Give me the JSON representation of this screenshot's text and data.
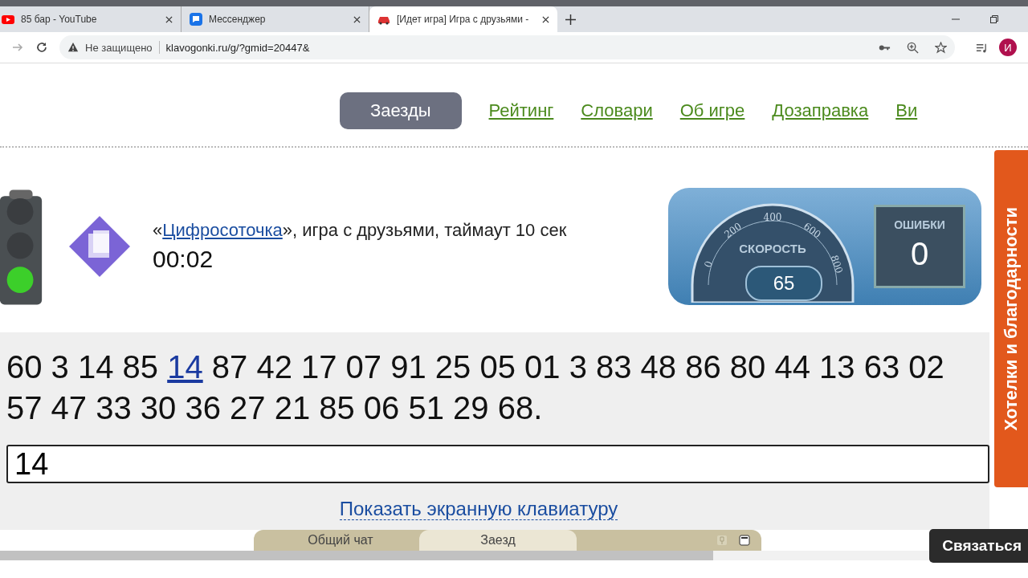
{
  "browser": {
    "tabs": [
      {
        "title": "85 бар - YouTube",
        "kind": "youtube",
        "selected": false
      },
      {
        "title": "Мессенджер",
        "kind": "messenger",
        "selected": false
      },
      {
        "title": "[Идет игра] Игра с друзьями -",
        "kind": "car",
        "selected": true
      }
    ],
    "security": "Не защищено",
    "url": "klavogonki.ru/g/?gmid=20447&",
    "avatar": "И"
  },
  "nav": [
    {
      "label": "Заезды",
      "selected": true
    },
    {
      "label": "Рейтинг",
      "selected": false
    },
    {
      "label": "Словари",
      "selected": false
    },
    {
      "label": "Об игре",
      "selected": false
    },
    {
      "label": "Дозаправка",
      "selected": false
    },
    {
      "label": "Ви",
      "selected": false
    }
  ],
  "game": {
    "quote_open": "«",
    "vocabulary": "Цифросоточка",
    "description": "», игра с друзьями, таймаут 10 сек",
    "timer": "00:02"
  },
  "dashboard": {
    "speed_label": "СКОРОСТЬ",
    "speed_ticks": [
      "0",
      "200",
      "400",
      "600",
      "800"
    ],
    "speed": "65",
    "errors_label": "ОШИБКИ",
    "errors": "0"
  },
  "text": {
    "typed": "60 3 14 85",
    "current": "14",
    "rest": "87 42 17 07 91 25 05 01 3 83 48 86 80 44 13 63 02 57 47 33 30 36 27 21 85 06 51 29 68."
  },
  "input": {
    "value": "14"
  },
  "keyboard_link": "Показать экранную клавиатуру",
  "chat_tabs": [
    {
      "label": "Общий чат",
      "selected": false
    },
    {
      "label": "Заезд",
      "selected": true
    }
  ],
  "side_tab": "Хотелки и благодарности",
  "contact_button": "Связаться"
}
